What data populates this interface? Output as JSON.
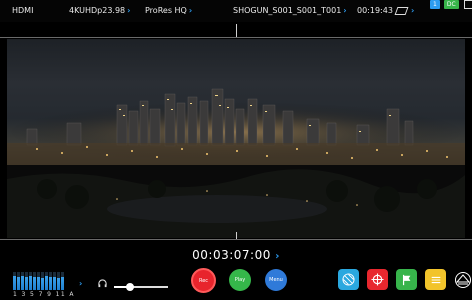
{
  "topbar": {
    "input": "HDMI",
    "resolution": "4KUHDp23.98",
    "codec": "ProRes HQ",
    "clip_name": "SHOGUN_S001_S001_T001",
    "remaining_time": "00:19:43",
    "channel_badge": "1",
    "power_badge": "DC"
  },
  "timecode": "00:03:07:00",
  "audio": {
    "channel_labels": "1 3 5 7 9 11 A",
    "levels": [
      0.75,
      0.7,
      0.8,
      0.72,
      0.78,
      0.7,
      0.74,
      0.69,
      0.76,
      0.71,
      0.73,
      0.68,
      0.72
    ],
    "volume_level": 0.3
  },
  "controls": {
    "rec_label": "Rec",
    "play_label": "Play",
    "menu_label": "Menu"
  },
  "tools": [
    "zebra-icon",
    "crosshair-icon",
    "flag-icon",
    "notes-icon",
    "focus-peaking-icon"
  ],
  "colors": {
    "accent_blue": "#2d9cf0",
    "rec_red": "#e8242c",
    "play_green": "#35b74a",
    "menu_blue": "#2f7ad9",
    "tool_cyan": "#2aa8df",
    "tool_red": "#e8272e",
    "tool_green": "#37b44b",
    "tool_yellow": "#f2c42b"
  }
}
